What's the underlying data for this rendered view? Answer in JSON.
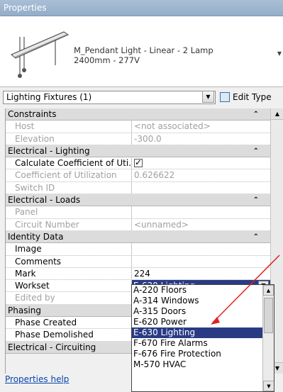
{
  "window": {
    "title": "Properties"
  },
  "type_selector": {
    "name": "M_Pendant Light - Linear - 2 Lamp\n2400mm - 277V",
    "name_line1": "M_Pendant Light - Linear - 2 Lamp",
    "name_line2": "2400mm - 277V"
  },
  "category": {
    "selected": "Lighting Fixtures (1)",
    "edit_type_label": "Edit Type"
  },
  "groups": [
    {
      "label": "Constraints",
      "rows": [
        {
          "key": "Host",
          "value": "<not associated>",
          "readonly": true
        },
        {
          "key": "Elevation",
          "value": "-300.0",
          "readonly": true
        }
      ]
    },
    {
      "label": "Electrical - Lighting",
      "rows": [
        {
          "key": "Calculate Coefficient of Uti...",
          "value": "",
          "checkbox": true
        },
        {
          "key": "Coefficient of Utilization",
          "value": "0.626622",
          "readonly": true
        },
        {
          "key": "Switch ID",
          "value": "",
          "readonly": true
        }
      ]
    },
    {
      "label": "Electrical - Loads",
      "rows": [
        {
          "key": "Panel",
          "value": "",
          "readonly": true
        },
        {
          "key": "Circuit Number",
          "value": "<unnamed>",
          "readonly": true
        }
      ]
    },
    {
      "label": "Identity Data",
      "rows": [
        {
          "key": "Image",
          "value": ""
        },
        {
          "key": "Comments",
          "value": ""
        },
        {
          "key": "Mark",
          "value": "224"
        },
        {
          "key": "Workset",
          "value": "E-630 Lighting"
        },
        {
          "key": "Edited by",
          "value": "",
          "readonly": true
        }
      ]
    },
    {
      "label": "Phasing",
      "rows": [
        {
          "key": "Phase Created",
          "value": ""
        },
        {
          "key": "Phase Demolished",
          "value": ""
        }
      ]
    },
    {
      "label": "Electrical - Circuiting",
      "rows": []
    }
  ],
  "workset_dropdown": {
    "options": [
      "A-220 Floors",
      "A-314 Windows",
      "A-315 Doors",
      "E-620 Power",
      "E-630 Lighting",
      "F-670 Fire Alarms",
      "F-676 Fire Protection",
      "M-570 HVAC"
    ],
    "selected_index": 4
  },
  "help_link": "Properties help",
  "colors": {
    "selection": "#2a3b84",
    "titlebar": "#a9bfd6",
    "annotation_arrow": "#e02020"
  }
}
